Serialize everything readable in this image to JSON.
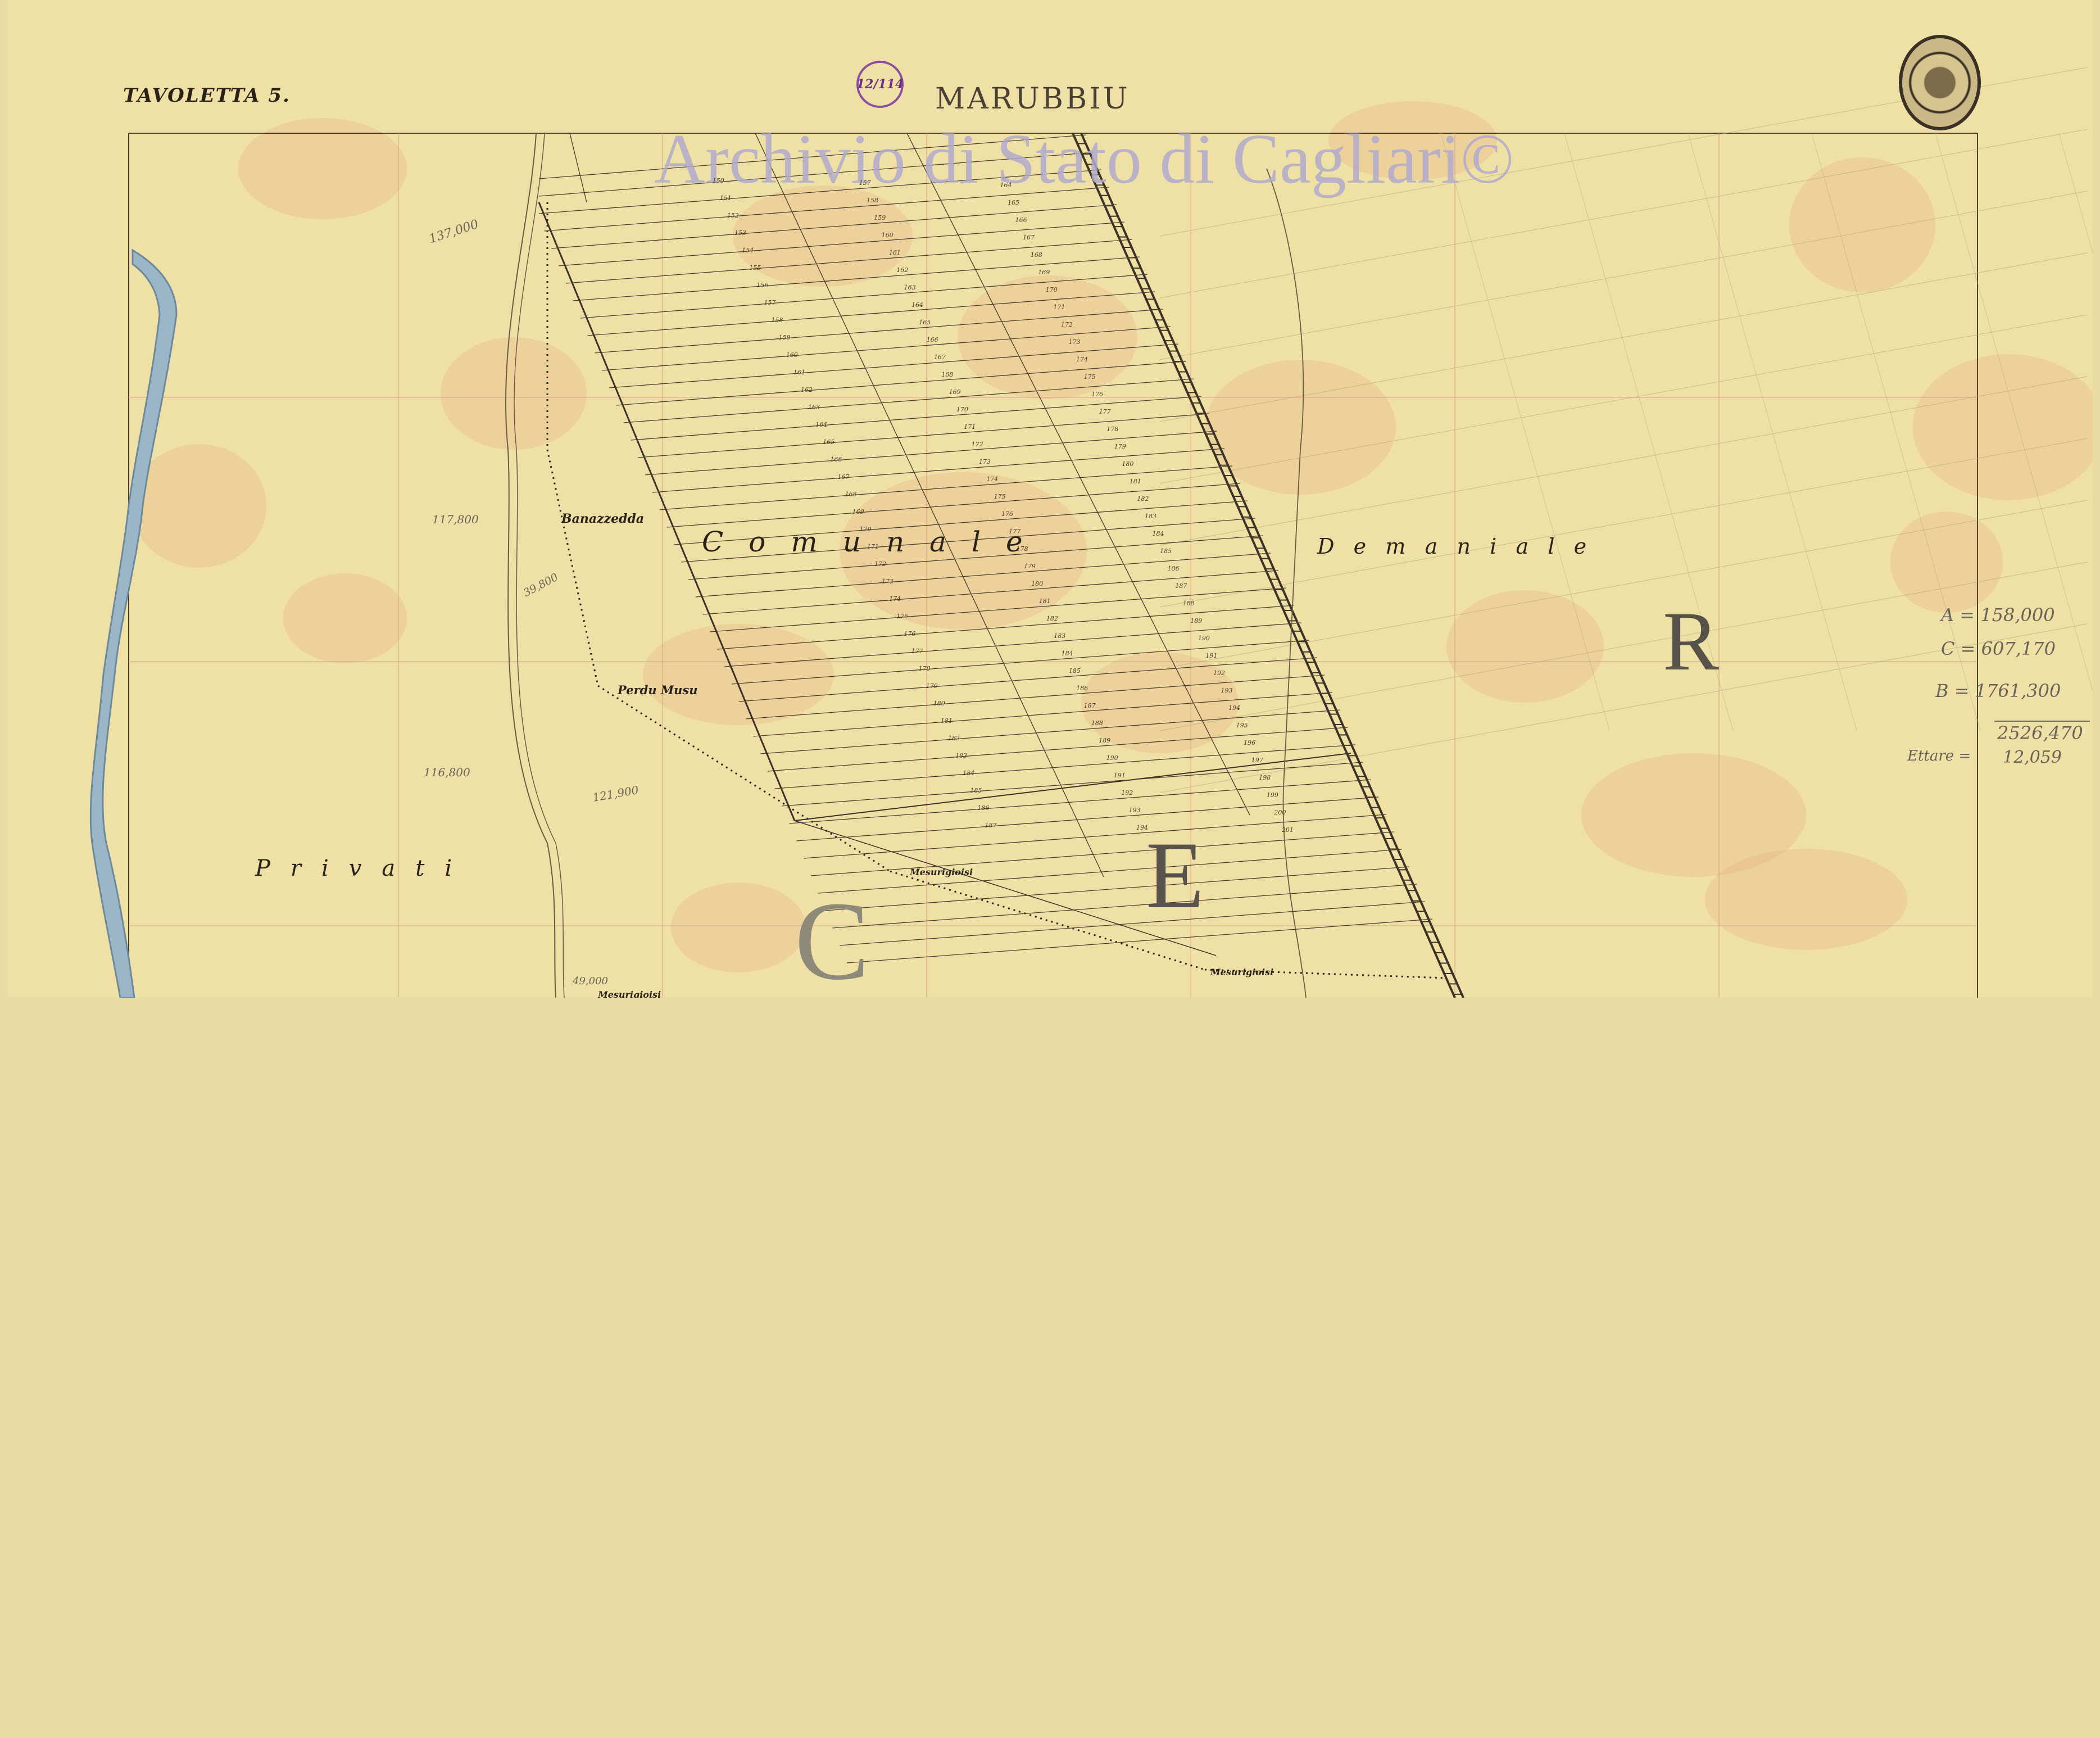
{
  "sheet": {
    "tavoletta": "TAVOLETTA 5.",
    "title": "MARUBBIU",
    "stamp_text": "12/114",
    "watermark": "Archivio di Stato di Cagliari©",
    "seal_icon": "archive-seal-icon"
  },
  "regions": {
    "comunale": "Comunale",
    "demaniale": "Demaniale",
    "privati": "Privati"
  },
  "placenames": [
    "Banazzedda",
    "Perdu Musu",
    "Mesurigioisi",
    "Mesurigioisi",
    "Mesurigioisi"
  ],
  "big_letters": [
    "R",
    "E",
    "C"
  ],
  "measurements": [
    "137,000",
    "117,800",
    "116,800",
    "121,900",
    "39,800",
    "49,000"
  ],
  "area_notes": {
    "a": "A = 158,000",
    "c": "C = 607,170",
    "b": "B = 1761,300",
    "total": "2526,470",
    "ettari_label": "Ettare =",
    "ettari": "12,059"
  },
  "colors": {
    "paper": "#efe1a6",
    "background": "#e8dca4",
    "river": "#9bb6c6",
    "ink": "#2a2218",
    "stain": "#e9b585"
  }
}
